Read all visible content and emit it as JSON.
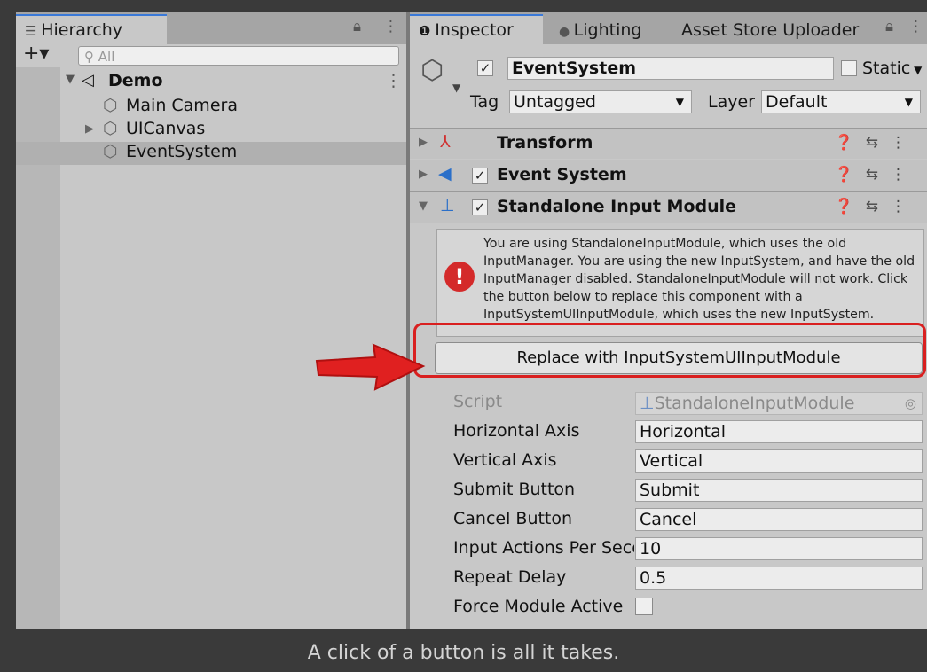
{
  "hierarchy": {
    "tab": "Hierarchy",
    "search_placeholder": "All",
    "scene": "Demo",
    "items": [
      "Main Camera",
      "UICanvas",
      "EventSystem"
    ]
  },
  "tabs": {
    "inspector": "Inspector",
    "lighting": "Lighting",
    "asset_store": "Asset Store Uploader"
  },
  "object": {
    "name": "EventSystem",
    "static_label": "Static",
    "tag_label": "Tag",
    "tag_value": "Untagged",
    "layer_label": "Layer",
    "layer_value": "Default"
  },
  "components": [
    "Transform",
    "Event System",
    "Standalone Input Module"
  ],
  "warning": "You are using StandaloneInputModule, which uses the old InputManager. You are using the new InputSystem, and have the old InputManager disabled. StandaloneInputModule will not work. Click the button below to replace this component with a InputSystemUIInputModule, which uses the new InputSystem.",
  "replace_button": "Replace with InputSystemUIInputModule",
  "fields": {
    "script_label": "Script",
    "script_value": "StandaloneInputModule",
    "horizontal_label": "Horizontal Axis",
    "horizontal_value": "Horizontal",
    "vertical_label": "Vertical Axis",
    "vertical_value": "Vertical",
    "submit_label": "Submit Button",
    "submit_value": "Submit",
    "cancel_label": "Cancel Button",
    "cancel_value": "Cancel",
    "actions_label": "Input Actions Per Seco",
    "actions_value": "10",
    "repeat_label": "Repeat Delay",
    "repeat_value": "0.5",
    "force_label": "Force Module Active"
  },
  "caption": "A click of a button is all it takes."
}
